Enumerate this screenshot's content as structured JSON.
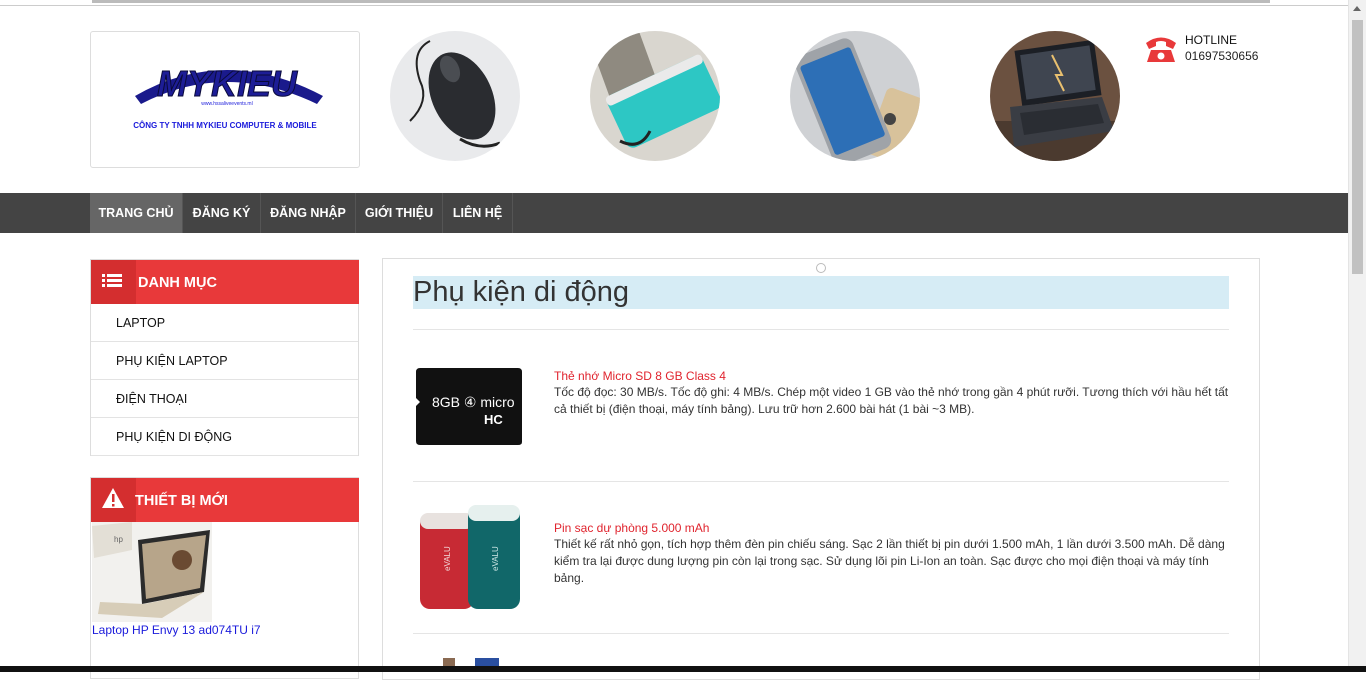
{
  "header": {
    "logo": {
      "brand": "MYKIEU",
      "website": "www.hssaliveevents.ml",
      "company": "CÔNG TY TNHH MYKIEU COMPUTER & MOBILE"
    },
    "banner_images": [
      "mouse-image",
      "powerbank-image",
      "phone-image",
      "laptop-image"
    ],
    "hotline_label": "HOTLINE",
    "hotline_number": "01697530656"
  },
  "nav": {
    "items": [
      "TRANG CHỦ",
      "ĐĂNG KÝ",
      "ĐĂNG NHẬP",
      "GIỚI THIỆU",
      "LIÊN HỆ"
    ],
    "active": "TRANG CHỦ"
  },
  "sidebar": {
    "category_title": "DANH MỤC",
    "categories": [
      "LAPTOP",
      "PHỤ KIỆN LAPTOP",
      "ĐIỆN THOẠI",
      "PHỤ KIỆN DI ĐỘNG"
    ],
    "new_title": "THIẾT BỊ MỚI",
    "new_item": "Laptop HP Envy 13 ad074TU i7"
  },
  "main": {
    "title": "Phụ kiện di động",
    "products": [
      {
        "name": "Thẻ nhớ Micro SD 8 GB Class 4",
        "desc": "Tốc độ đọc: 30 MB/s. Tốc độ ghi: 4 MB/s. Chép một video 1 GB vào thẻ nhớ trong gần 4 phút rưỡi. Tương thích với hầu hết tất cả thiết bị (điện thoại, máy tính bảng). Lưu trữ hơn 2.600 bài hát (1 bài ~3 MB).",
        "image_label": "8GB microSD HC"
      },
      {
        "name": "Pin sạc dự phòng 5.000 mAh",
        "desc": "Thiết kế rất nhỏ gọn, tích hợp thêm đèn pin chiếu sáng. Sạc 2 lần thiết bị pin dưới 1.500 mAh, 1 lần dưới 3.500 mAh. Dễ dàng kiểm tra lại được dung lượng pin còn lại trong sạc. Sử dụng lõi pin Li-Ion an toàn. Sạc được cho mọi điện thoại và máy tính bảng.",
        "image_label": "eVALU"
      }
    ]
  },
  "colors": {
    "accent_red": "#e8393a",
    "nav_bg": "#444444",
    "title_bg": "#d6ecf5",
    "link_blue": "#1a1adb"
  }
}
